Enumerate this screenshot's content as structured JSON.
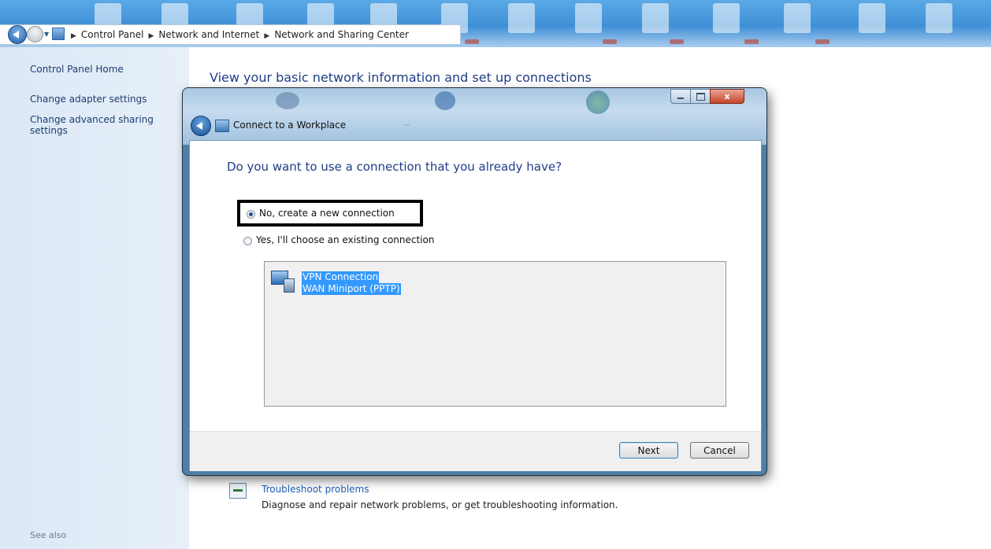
{
  "breadcrumb": {
    "items": [
      "Control Panel",
      "Network and Internet",
      "Network and Sharing Center"
    ]
  },
  "leftnav": {
    "home": "Control Panel Home",
    "adapter": "Change adapter settings",
    "advanced_line1": "Change advanced sharing",
    "advanced_line2": "settings",
    "see_also": "See also"
  },
  "main": {
    "title": "View your basic network information and set up connections",
    "troubleshoot_link": "Troubleshoot problems",
    "troubleshoot_desc": "Diagnose and repair network problems, or get troubleshooting information."
  },
  "dialog": {
    "title": "Connect to a Workplace",
    "close_glyph": "x",
    "question": "Do you want to use a connection that you already have?",
    "options": {
      "new": "No, create a new connection",
      "existing": "Yes, I'll choose an existing connection"
    },
    "selected_option": "new",
    "connection": {
      "name": "VPN Connection",
      "device": "WAN Miniport (PPTP)"
    },
    "buttons": {
      "next": "Next",
      "cancel": "Cancel"
    }
  },
  "colors": {
    "link": "#1e3d87",
    "selection": "#3399ff"
  }
}
